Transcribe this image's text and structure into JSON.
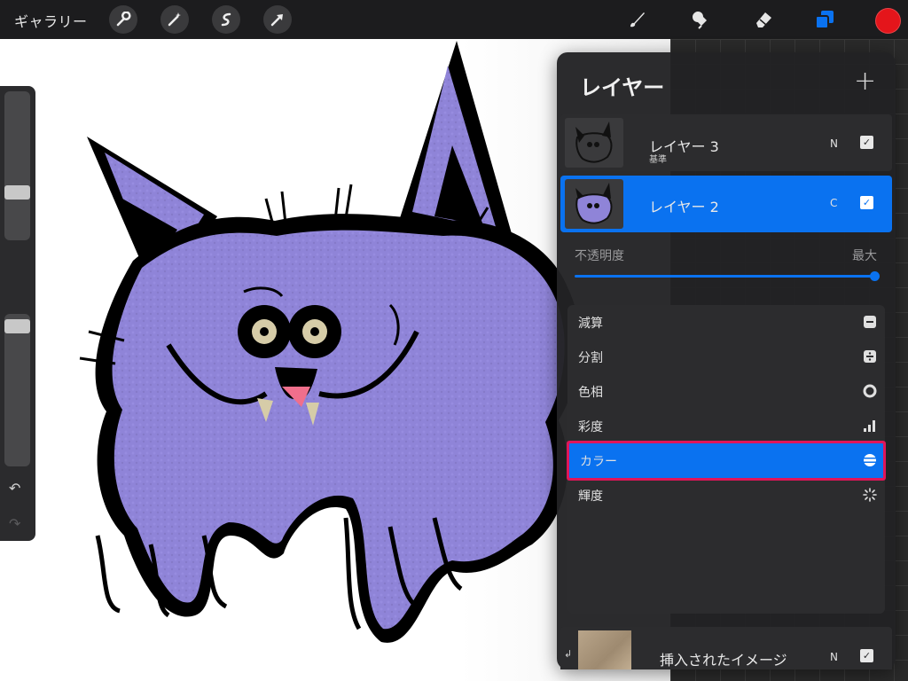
{
  "topbar": {
    "gallery_label": "ギャラリー",
    "left_tools": [
      "wrench-icon",
      "magic-wand-icon",
      "selection-icon",
      "transform-arrow-icon"
    ],
    "right_tools": [
      "brush-icon",
      "smudge-icon",
      "eraser-icon",
      "layers-icon"
    ],
    "current_color": "#e4151b",
    "accent": "#0a72f0"
  },
  "sidebar": {
    "brush_size_level": 0.3,
    "opacity_level": 0.96
  },
  "layers_panel": {
    "title": "レイヤー",
    "add_label": "+",
    "layers": [
      {
        "name": "レイヤー 3",
        "sublabel": "基準",
        "blend": "N",
        "visible": true,
        "active": false
      },
      {
        "name": "レイヤー 2",
        "sublabel": "",
        "blend": "C",
        "visible": true,
        "active": true
      }
    ],
    "opacity_label": "不透明度",
    "opacity_max_label": "最大",
    "opacity_value": 1.0,
    "blend_modes": [
      {
        "label": "減算",
        "icon": "subtract-icon"
      },
      {
        "label": "分割",
        "icon": "divide-icon"
      },
      {
        "label": "色相",
        "icon": "hue-icon"
      },
      {
        "label": "彩度",
        "icon": "saturation-icon"
      },
      {
        "label": "カラー",
        "icon": "color-mode-icon",
        "selected": true
      },
      {
        "label": "輝度",
        "icon": "luminosity-icon"
      }
    ],
    "bottom_layer": {
      "name": "挿入されたイメージ",
      "blend": "N",
      "visible": true
    }
  }
}
